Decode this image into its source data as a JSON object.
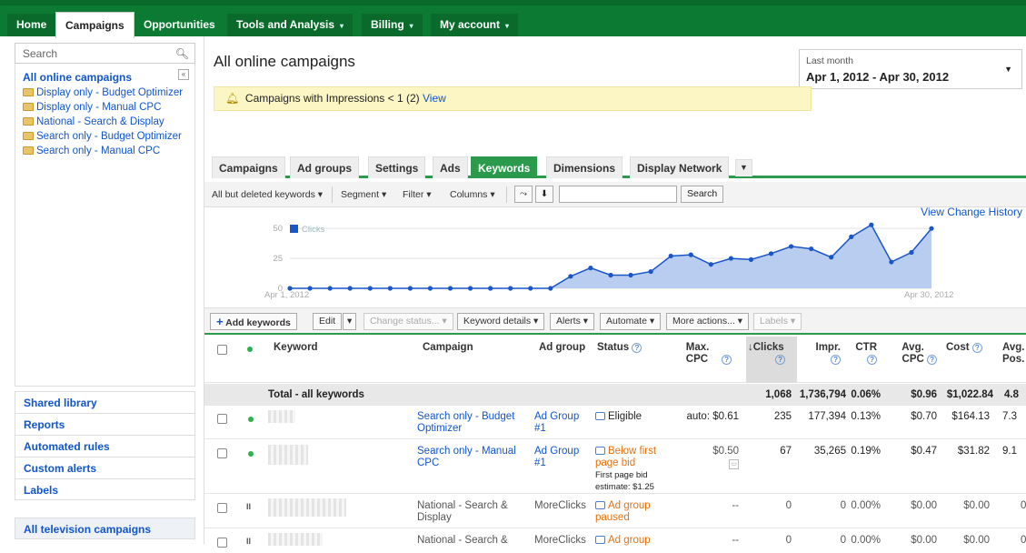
{
  "topnav": {
    "tabs": [
      {
        "label": "Home",
        "dropdown": false
      },
      {
        "label": "Campaigns",
        "dropdown": false,
        "active": true
      },
      {
        "label": "Opportunities",
        "dropdown": false
      },
      {
        "label": "Tools and Analysis",
        "dropdown": true
      },
      {
        "label": "Billing",
        "dropdown": true
      },
      {
        "label": "My account",
        "dropdown": true
      }
    ]
  },
  "sidebar": {
    "search_placeholder": "Search",
    "root": "All online campaigns",
    "campaigns": [
      "Display only - Budget Optimizer",
      "Display only - Manual CPC",
      "National - Search & Display",
      "Search only - Budget Optimizer",
      "Search only - Manual CPC"
    ],
    "links": [
      "Shared library",
      "Reports",
      "Automated rules",
      "Custom alerts",
      "Labels"
    ],
    "tv": "All television campaigns"
  },
  "main": {
    "title": "All online campaigns",
    "date": {
      "label": "Last month",
      "range": "Apr 1, 2012 - Apr 30, 2012"
    },
    "alert": {
      "text": "Campaigns with Impressions < 1 (2)",
      "link": "View"
    },
    "tabs": [
      "Campaigns",
      "Ad groups",
      "Settings",
      "Ads",
      "Keywords",
      "Dimensions",
      "Display Network"
    ],
    "active_tab": "Keywords",
    "filters": {
      "keywords_filter": "All but deleted keywords",
      "segment": "Segment",
      "filter": "Filter",
      "columns": "Columns",
      "search_button": "Search"
    },
    "view_change_history": "View Change History",
    "actions": {
      "add": "Add keywords",
      "edit": "Edit",
      "change_status": "Change status...",
      "keyword_details": "Keyword details",
      "alerts": "Alerts",
      "automate": "Automate",
      "more_actions": "More actions...",
      "labels": "Labels"
    },
    "columns": {
      "keyword": "Keyword",
      "campaign": "Campaign",
      "ad_group": "Ad group",
      "status": "Status",
      "max_cpc": "Max. CPC",
      "clicks": "Clicks",
      "impr": "Impr.",
      "ctr": "CTR",
      "avg_cpc": "Avg. CPC",
      "cost": "Cost",
      "avg_pos": "Avg. Pos."
    },
    "total": {
      "label": "Total - all keywords",
      "clicks": "1,068",
      "impr": "1,736,794",
      "ctr": "0.06%",
      "avg_cpc": "$0.96",
      "cost": "$1,022.84",
      "avg_pos": "4.8"
    },
    "rows": [
      {
        "campaign": "Search only - Budget Optimizer",
        "ad_group": "Ad Group #1",
        "status": "Eligible",
        "status_note": "",
        "max_cpc": "auto: $0.61",
        "clicks": "235",
        "impr": "177,394",
        "ctr": "0.13%",
        "avg_cpc": "$0.70",
        "cost": "$164.13",
        "avg_pos": "7.3"
      },
      {
        "campaign": "Search only - Manual CPC",
        "ad_group": "Ad Group #1",
        "status": "Below first page bid",
        "status_note": "First page bid estimate: $1.25",
        "max_cpc": "$0.50",
        "clicks": "67",
        "impr": "35,265",
        "ctr": "0.19%",
        "avg_cpc": "$0.47",
        "cost": "$31.82",
        "avg_pos": "9.1"
      },
      {
        "campaign": "National - Search & Display",
        "ad_group": "MoreClicks",
        "status": "Ad group paused",
        "status_note": "",
        "max_cpc": "--",
        "clicks": "0",
        "impr": "0",
        "ctr": "0.00%",
        "avg_cpc": "$0.00",
        "cost": "$0.00",
        "avg_pos": "0"
      },
      {
        "campaign": "National - Search &",
        "ad_group": "MoreClicks",
        "status": "Ad group",
        "status_note": "",
        "max_cpc": "--",
        "clicks": "0",
        "impr": "0",
        "ctr": "0.00%",
        "avg_cpc": "$0.00",
        "cost": "$0.00",
        "avg_pos": "0"
      }
    ]
  },
  "chart_data": {
    "type": "area",
    "series": [
      {
        "name": "Clicks",
        "values": [
          0,
          0,
          0,
          0,
          0,
          0,
          0,
          0,
          0,
          0,
          0,
          0,
          0,
          0,
          10,
          17,
          11,
          11,
          14,
          27,
          28,
          20,
          25,
          24,
          29,
          35,
          33,
          26,
          43,
          53,
          22,
          30,
          50
        ]
      }
    ],
    "yticks": [
      "0",
      "25",
      "50"
    ],
    "ylim": [
      0,
      60
    ],
    "x_start_label": "Apr 1, 2012",
    "x_end_label": "Apr 30, 2012",
    "color": "#1a56c8",
    "fill": "#b9cdf0"
  }
}
